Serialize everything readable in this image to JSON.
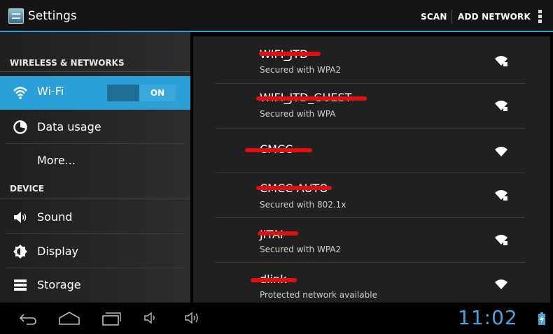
{
  "action_bar": {
    "title": "Settings",
    "scan_label": "SCAN",
    "add_network_label": "ADD NETWORK"
  },
  "sidebar": {
    "sections": [
      {
        "header": "WIRELESS & NETWORKS"
      },
      {
        "header": "DEVICE"
      }
    ],
    "items": [
      {
        "label": "Wi-Fi",
        "icon": "wifi-icon",
        "active": true,
        "toggle": "ON"
      },
      {
        "label": "Data usage",
        "icon": "data-usage-icon"
      },
      {
        "label": "More...",
        "icon": ""
      },
      {
        "label": "Sound",
        "icon": "speaker-icon"
      },
      {
        "label": "Display",
        "icon": "brightness-icon"
      },
      {
        "label": "Storage",
        "icon": "storage-icon"
      }
    ]
  },
  "networks": [
    {
      "name": "WIFI_JTD",
      "status": "Secured with WPA2",
      "secured": true
    },
    {
      "name": "WIFI_JTD_GUEST",
      "status": "Secured with WPA",
      "secured": true
    },
    {
      "name": "CMCC",
      "status": "",
      "secured": false
    },
    {
      "name": "CMCC-AUTO",
      "status": "Secured with 802.1x",
      "secured": true
    },
    {
      "name": "JITAI",
      "status": "Secured with WPA2",
      "secured": true
    },
    {
      "name": "dlink",
      "status": "Protected network available",
      "secured": false
    }
  ],
  "system_bar": {
    "clock": "11:02",
    "icons": [
      "back-icon",
      "home-icon",
      "recent-apps-icon",
      "volume-down-icon",
      "volume-up-icon",
      "battery-charging-icon"
    ]
  },
  "colors": {
    "accent": "#2a9fd8",
    "redaction": "#e01010",
    "clock": "#4aa3d6"
  }
}
